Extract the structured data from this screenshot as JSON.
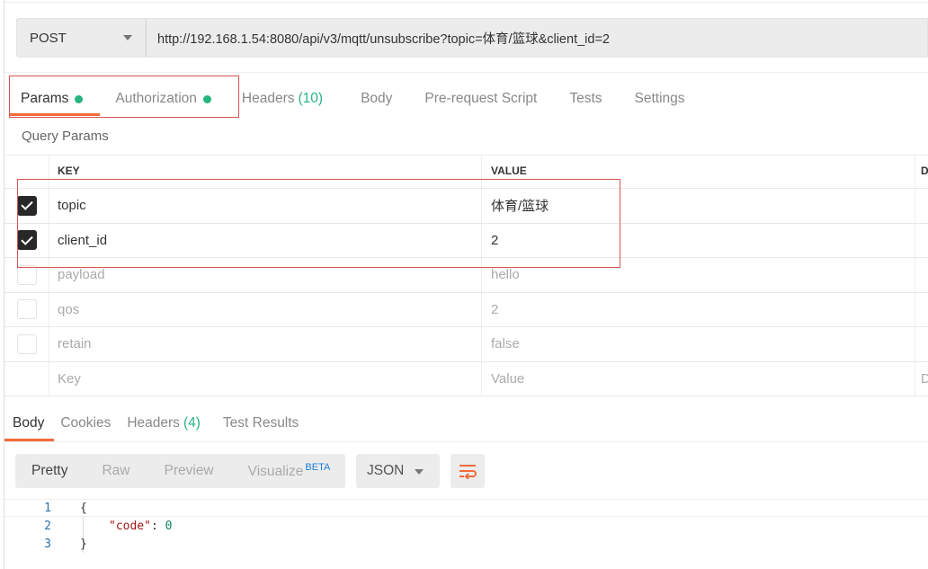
{
  "request": {
    "method": "POST",
    "url": "http://192.168.1.54:8080/api/v3/mqtt/unsubscribe?topic=体育/篮球&client_id=2"
  },
  "tabs": [
    {
      "label": "Params",
      "dot": true,
      "active": true
    },
    {
      "label": "Authorization",
      "dot": true
    },
    {
      "label": "Headers",
      "count": "(10)"
    },
    {
      "label": "Body"
    },
    {
      "label": "Pre-request Script"
    },
    {
      "label": "Tests"
    },
    {
      "label": "Settings"
    }
  ],
  "query_params": {
    "title": "Query Params",
    "headers": {
      "key": "KEY",
      "value": "VALUE",
      "description": "DESCRIPTION"
    },
    "rows": [
      {
        "checked": true,
        "key": "topic",
        "value": "体育/篮球"
      },
      {
        "checked": true,
        "key": "client_id",
        "value": "2"
      },
      {
        "checked": false,
        "key": "payload",
        "value": "hello"
      },
      {
        "checked": false,
        "key": "qos",
        "value": "2"
      },
      {
        "checked": false,
        "key": "retain",
        "value": "false"
      }
    ],
    "placeholder": {
      "key": "Key",
      "value": "Value",
      "description": "Description"
    }
  },
  "response": {
    "tabs": [
      {
        "label": "Body",
        "active": true
      },
      {
        "label": "Cookies"
      },
      {
        "label": "Headers",
        "count": "(4)"
      },
      {
        "label": "Test Results"
      }
    ],
    "views": [
      "Pretty",
      "Raw",
      "Preview",
      "Visualize"
    ],
    "beta": "BETA",
    "format": "JSON",
    "wrap_icon": "wrap-lines-icon",
    "code": {
      "line_numbers": [
        "1",
        "2",
        "3"
      ],
      "open": "{",
      "key": "\"code\"",
      "colon": ": ",
      "value": "0",
      "close": "}"
    }
  },
  "colors": {
    "accent": "#f26b3a",
    "dot": "#26b47f",
    "highlight": "#d9534f"
  }
}
